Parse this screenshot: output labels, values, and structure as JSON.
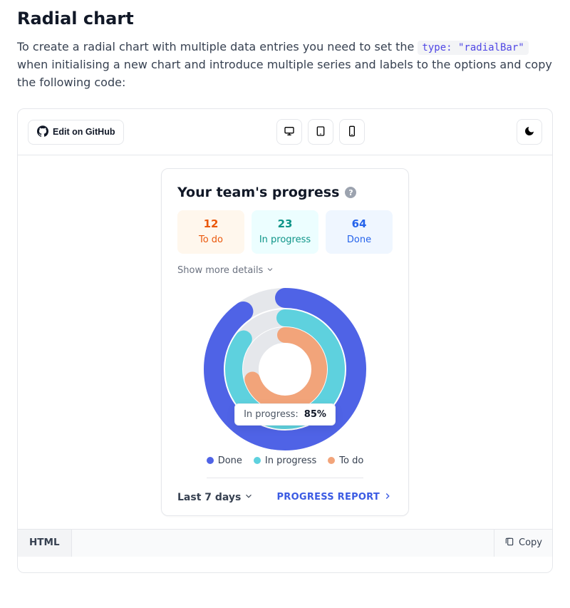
{
  "heading": "Radial chart",
  "intro": {
    "before": "To create a radial chart with multiple data entries you need to set the ",
    "code": "type: \"radialBar\"",
    "after": " when initialising a new chart and introduce multiple series and labels to the options and copy the following code:"
  },
  "toolbar": {
    "edit_label": "Edit on GitHub"
  },
  "card": {
    "title": "Your team's progress",
    "help_glyph": "?",
    "stats": [
      {
        "value": "12",
        "label": "To do"
      },
      {
        "value": "23",
        "label": "In progress"
      },
      {
        "value": "64",
        "label": "Done"
      }
    ],
    "show_more": "Show more details",
    "tooltip": {
      "label": "In progress:",
      "value": "85%"
    },
    "legend": [
      {
        "name": "Done",
        "color": "#4f63e6"
      },
      {
        "name": "In progress",
        "color": "#5ed1de"
      },
      {
        "name": "To do",
        "color": "#f2a47a"
      }
    ],
    "footer": {
      "range": "Last 7 days",
      "report": "PROGRESS REPORT"
    }
  },
  "codebar": {
    "tab": "HTML",
    "copy": "Copy"
  },
  "chart_data": {
    "type": "radialBar",
    "series": [
      {
        "name": "Done",
        "value": 90,
        "color": "#4f63e6"
      },
      {
        "name": "In progress",
        "value": 85,
        "color": "#5ed1de"
      },
      {
        "name": "To do",
        "value": 70,
        "color": "#f2a47a"
      }
    ],
    "max": 100,
    "unit": "%",
    "hollow_center": true,
    "tooltip_series": "In progress"
  }
}
